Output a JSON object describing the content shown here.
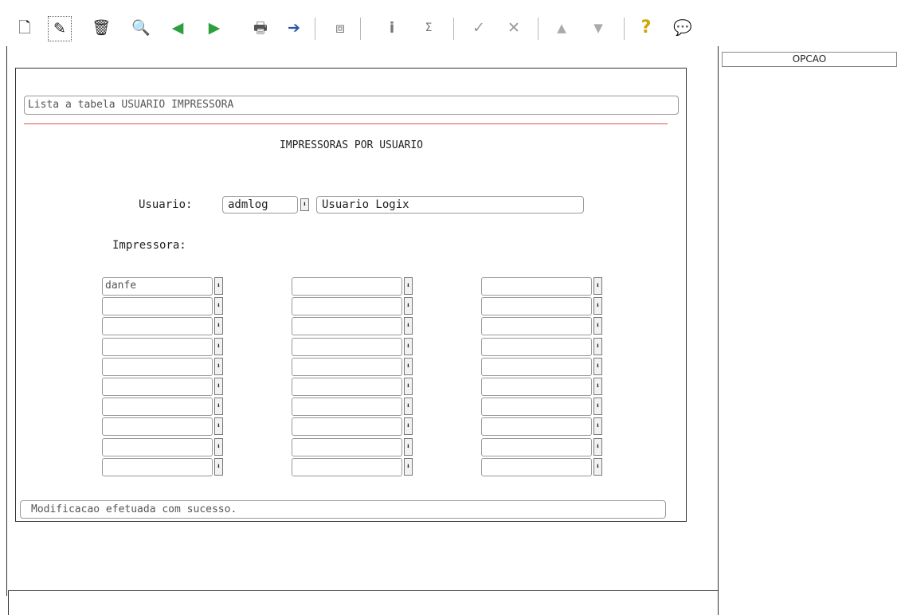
{
  "toolbar": {
    "icons": [
      "new-icon",
      "modify-icon",
      "delete-icon",
      "search-icon",
      "previous-icon",
      "next-icon",
      "print-icon",
      "exit-icon",
      "find-icon",
      "info-icon",
      "sum-icon",
      "confirm-icon",
      "cancel-icon",
      "up-icon",
      "down-icon",
      "help-icon",
      "comment-icon"
    ],
    "glyphs": [
      "🗋",
      "✎",
      "🗑",
      "🔍",
      "◀",
      "▶",
      "🖶",
      "➔",
      "⧈",
      "i",
      "Σ",
      "✓",
      "✕",
      "▲",
      "▼",
      "?",
      "💬"
    ]
  },
  "side": {
    "opcao_label": "OPCAO"
  },
  "form": {
    "header_text": "Lista a tabela USUARIO IMPRESSORA",
    "title": "IMPRESSORAS POR USUARIO",
    "usuario_label": "Usuario:",
    "usuario_code": "admlog",
    "usuario_name": "Usuario Logix",
    "impressora_label": "Impressora:",
    "dropdown_glyph": "⬇",
    "printers_col1": [
      "danfe",
      "",
      "",
      "",
      "",
      "",
      "",
      "",
      "",
      ""
    ],
    "printers_col2": [
      "",
      "",
      "",
      "",
      "",
      "",
      "",
      "",
      "",
      ""
    ],
    "printers_col3": [
      "",
      "",
      "",
      "",
      "",
      "",
      "",
      "",
      "",
      ""
    ],
    "status_message": "Modificacao efetuada com sucesso."
  },
  "colors": {
    "accent_line": "#e05050"
  }
}
